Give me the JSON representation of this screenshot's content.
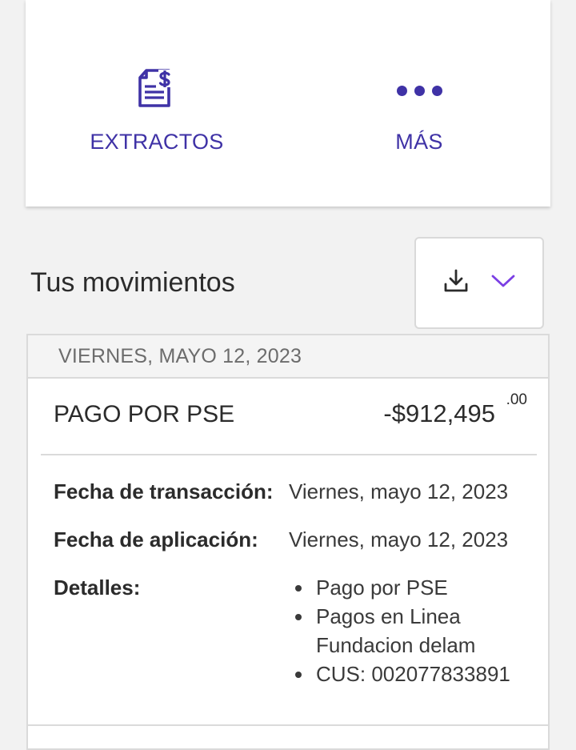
{
  "colors": {
    "accent": "#3f32a6",
    "chevron": "#7b3fe4"
  },
  "quick_actions": {
    "extractos": {
      "label": "EXTRACTOS",
      "icon": "statement-dollar-icon"
    },
    "mas": {
      "label": "MÁS",
      "icon": "more-dots-icon"
    }
  },
  "movements": {
    "title": "Tus movimientos",
    "download_icon": "download-icon",
    "dropdown_icon": "chevron-down-icon"
  },
  "transaction": {
    "date_header": "VIERNES, MAYO 12, 2023",
    "name": "PAGO POR PSE",
    "amount": "-$912,495",
    "cents": ".00",
    "details": {
      "transaction_date_label": "Fecha de transacción:",
      "transaction_date_value": "Viernes, mayo 12, 2023",
      "application_date_label": "Fecha de aplicación:",
      "application_date_value": "Viernes, mayo 12, 2023",
      "details_label": "Detalles:",
      "items": [
        "Pago por PSE",
        "Pagos en Linea Fundacion delam",
        "CUS: 002077833891"
      ]
    }
  }
}
